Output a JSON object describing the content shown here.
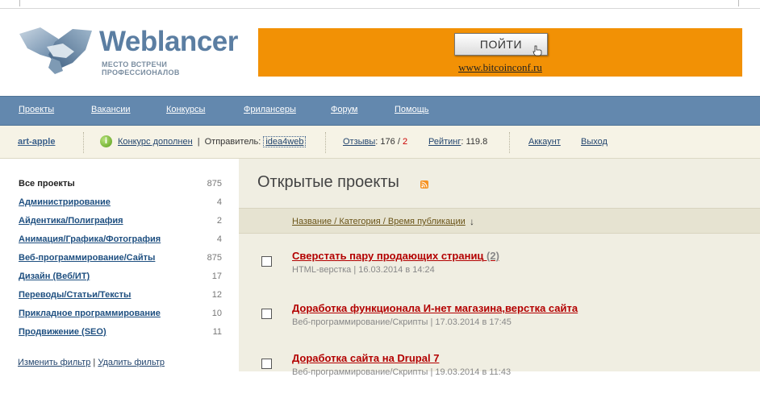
{
  "header": {
    "logo_word": "Weblancer",
    "logo_tagline": "МЕСТО ВСТРЕЧИ ПРОФЕССИОНАЛОВ"
  },
  "banner": {
    "button_label": "ПОЙТИ",
    "url_text": "www.bitcoinconf.ru",
    "color": "#f29105"
  },
  "nav": {
    "items": [
      "Проекты",
      "Вакансии",
      "Конкурсы",
      "Фрилансеры",
      "Форум",
      "Помощь"
    ]
  },
  "userbar": {
    "username": "art-apple",
    "notice_link": "Конкурс дополнен",
    "sender_label": "Отправитель:",
    "sender_name": "idea4web",
    "reviews_label": "Отзывы",
    "reviews_positive": "176",
    "reviews_separator": "/",
    "reviews_negative": "2",
    "rating_label": "Рейтинг",
    "rating_value": "119.8",
    "account_link": "Аккаунт",
    "logout_link": "Выход"
  },
  "sidebar": {
    "categories": [
      {
        "name": "Все проекты",
        "count": "875"
      },
      {
        "name": "Администрирование",
        "count": "4"
      },
      {
        "name": "Айдентика/Полиграфия",
        "count": "2"
      },
      {
        "name": "Анимация/Графика/Фотография",
        "count": "4"
      },
      {
        "name": "Веб-программирование/Сайты",
        "count": "875"
      },
      {
        "name": "Дизайн (Веб/ИТ)",
        "count": "17"
      },
      {
        "name": "Переводы/Статьи/Тексты",
        "count": "12"
      },
      {
        "name": "Прикладное программирование",
        "count": "10"
      },
      {
        "name": "Продвижение (SEO)",
        "count": "11"
      }
    ],
    "change_filter": "Изменить фильтр",
    "filter_separator": "|",
    "delete_filter": "Удалить фильтр"
  },
  "main": {
    "title": "Открытые проекты",
    "sort_link": "Название / Категория / Время публикации",
    "sort_arrow": "↓",
    "projects": [
      {
        "title": "Сверстать пару продающих страниц",
        "count": "(2)",
        "meta": "HTML-верстка | 16.03.2014 в 14:24"
      },
      {
        "title": "Доработка функционала И-нет магазина,верстка сайта",
        "count": "",
        "meta": "Веб-программирование/Скрипты | 17.03.2014 в 17:45"
      },
      {
        "title": "Доработка сайта на Drupal 7",
        "count": "",
        "meta": "Веб-программирование/Скрипты | 19.03.2014 в 11:43"
      }
    ]
  },
  "colors": {
    "nav_bg": "#6388ae",
    "userbar_bg": "#f6f3e6",
    "main_bg": "#f0eee2",
    "project_title": "#b30000"
  }
}
